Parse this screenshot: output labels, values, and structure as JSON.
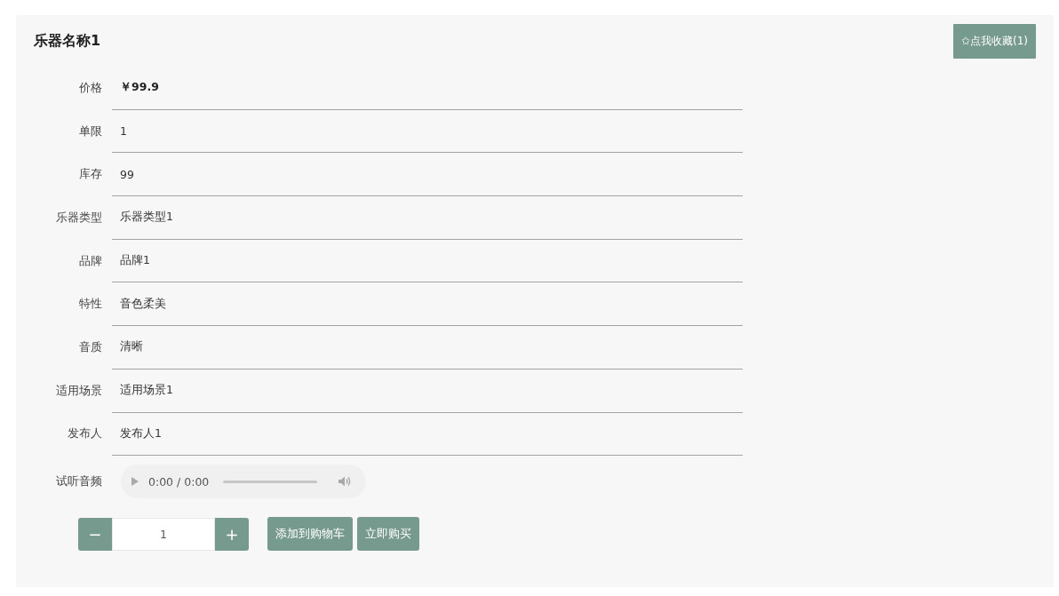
{
  "product": {
    "title": "乐器名称1",
    "favorite_button": "✩点我收藏(1)"
  },
  "details": [
    {
      "label": "价格",
      "value": "￥99.9",
      "kind": "price"
    },
    {
      "label": "单限",
      "value": "1",
      "kind": "text"
    },
    {
      "label": "库存",
      "value": "99",
      "kind": "text"
    },
    {
      "label": "乐器类型",
      "value": "乐器类型1",
      "kind": "text"
    },
    {
      "label": "品牌",
      "value": "品牌1",
      "kind": "text"
    },
    {
      "label": "特性",
      "value": "音色柔美",
      "kind": "text"
    },
    {
      "label": "音质",
      "value": "清晰",
      "kind": "text"
    },
    {
      "label": "适用场景",
      "value": "适用场景1",
      "kind": "text"
    },
    {
      "label": "发布人",
      "value": "发布人1",
      "kind": "text"
    }
  ],
  "audio": {
    "label": "试听音频",
    "time": "0:00 / 0:00",
    "level": 0
  },
  "quantity": {
    "minus": "−",
    "value": "1",
    "plus": "+"
  },
  "actions": [
    "添加到购物车",
    "立即购买"
  ]
}
